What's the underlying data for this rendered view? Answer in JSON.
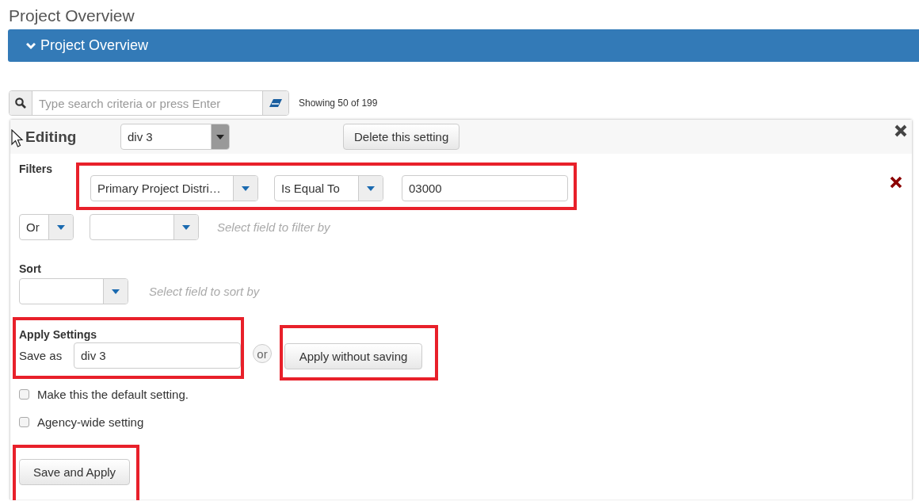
{
  "page_title": "Project Overview",
  "section_bar": {
    "label": "Project Overview",
    "expanded": true
  },
  "search": {
    "placeholder": "Type search criteria or press Enter",
    "count": "Showing 50 of 199"
  },
  "editor": {
    "label": "Editing",
    "setting": "div 3",
    "delete_button": "Delete this setting",
    "filters": {
      "label": "Filters",
      "highlighted": true,
      "conditions": [
        {
          "field": "Primary Project Distri…",
          "operator": "Is Equal To",
          "value": "03000"
        }
      ],
      "new_condition": {
        "connector": "Or",
        "hint": "Select field to filter by"
      }
    },
    "sort": {
      "label": "Sort",
      "hint": "Select field to sort by"
    },
    "apply": {
      "label": "Apply Settings",
      "highlighted": true,
      "save_as_label": "Save as",
      "save_as_value": "div 3",
      "or_label": "or",
      "apply_button": {
        "label": "Apply without saving",
        "highlighted": true
      }
    },
    "options": [
      {
        "label": "Make this the default setting.",
        "checked": false
      },
      {
        "label": "Agency-wide setting",
        "checked": false
      }
    ],
    "save_button": {
      "label": "Save and Apply",
      "highlighted": true
    }
  }
}
